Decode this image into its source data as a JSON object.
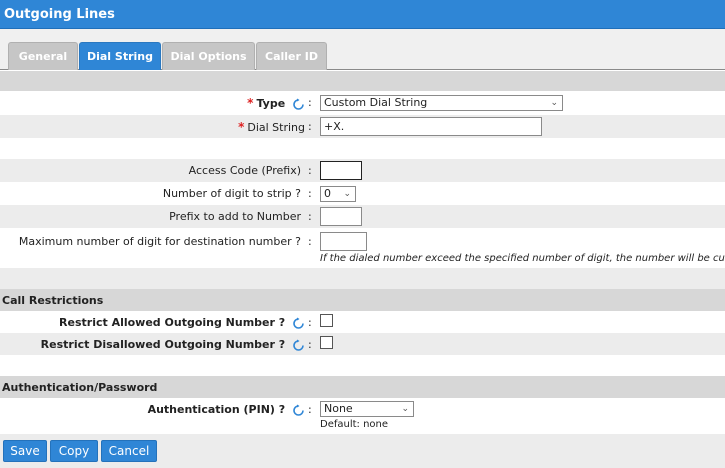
{
  "window": {
    "title": "Outgoing Lines"
  },
  "tabs": [
    {
      "label": "General"
    },
    {
      "label": "Dial String"
    },
    {
      "label": "Dial Options"
    },
    {
      "label": "Caller ID"
    }
  ],
  "required_marker": "*",
  "colon": ":",
  "fields": {
    "type": {
      "label": "Type",
      "value": "Custom Dial String"
    },
    "dial_string": {
      "label": "Dial String",
      "value": "+X."
    },
    "access_code": {
      "label": "Access Code (Prefix)",
      "value": ""
    },
    "digits_strip": {
      "label": "Number of digit to strip ?",
      "value": "0"
    },
    "prefix_add": {
      "label": "Prefix to add to Number",
      "value": ""
    },
    "max_digits": {
      "label": "Maximum number of digit for destination number ?",
      "value": "",
      "hint": "If the dialed number exceed the specified number of digit, the number will be cut."
    }
  },
  "call_restrictions": {
    "title": "Call Restrictions",
    "allowed": {
      "label": "Restrict Allowed Outgoing Number ?",
      "checked": false
    },
    "disallowed": {
      "label": "Restrict Disallowed Outgoing Number ?",
      "checked": false
    }
  },
  "authentication": {
    "title": "Authentication/Password",
    "pin": {
      "label": "Authentication (PIN) ?",
      "value": "None",
      "default_text": "Default: none"
    }
  },
  "buttons": {
    "save": "Save",
    "copy": "Copy",
    "cancel": "Cancel"
  },
  "colors": {
    "accent": "#2f86d6",
    "tab_inactive": "#c6c6c6",
    "required": "#dd2222"
  }
}
